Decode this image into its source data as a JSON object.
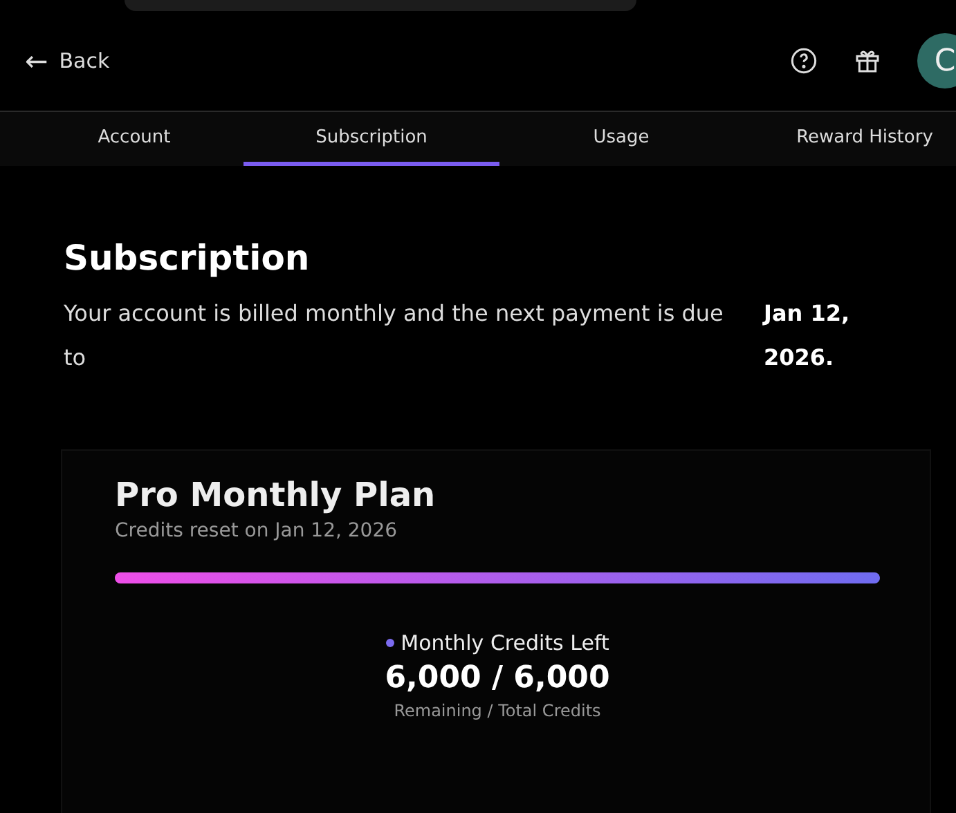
{
  "header": {
    "back": {
      "icon": "←",
      "label": "Back"
    },
    "avatar": {
      "initial": "C"
    }
  },
  "tabs": [
    {
      "label": "Account",
      "selected": false
    },
    {
      "label": "Subscription",
      "selected": true
    },
    {
      "label": "Usage",
      "selected": false
    },
    {
      "label": "Reward History",
      "selected": false
    }
  ],
  "subscription": {
    "title": "Subscription",
    "billing_text": "Your account is billed monthly and the next payment is due to",
    "due_date": "Jan 12, 2026."
  },
  "plan": {
    "name": "Pro Monthly Plan",
    "reset_text": "Credits reset on Jan 12, 2026",
    "level": 1,
    "credits": {
      "label": "Monthly Credits Left",
      "color": "#7c6cf0",
      "value": "6,000 / 6,000",
      "caption": "Remaining / Total Credits"
    }
  }
}
